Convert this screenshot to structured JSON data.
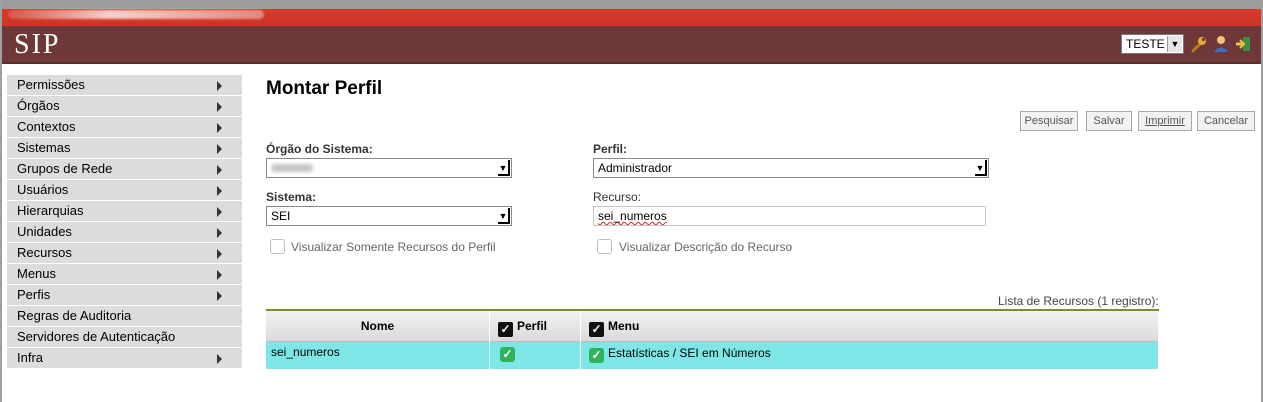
{
  "header": {
    "app_logo": "SIP",
    "org_select_value": "TESTE",
    "icons": [
      "wrench-icon",
      "user-icon",
      "exit-icon"
    ]
  },
  "sidebar": {
    "items": [
      {
        "label": "Permissões",
        "has_submenu": true
      },
      {
        "label": "Órgãos",
        "has_submenu": true
      },
      {
        "label": "Contextos",
        "has_submenu": true
      },
      {
        "label": "Sistemas",
        "has_submenu": true
      },
      {
        "label": "Grupos de Rede",
        "has_submenu": true
      },
      {
        "label": "Usuários",
        "has_submenu": true
      },
      {
        "label": "Hierarquias",
        "has_submenu": true
      },
      {
        "label": "Unidades",
        "has_submenu": true
      },
      {
        "label": "Recursos",
        "has_submenu": true
      },
      {
        "label": "Menus",
        "has_submenu": true
      },
      {
        "label": "Perfis",
        "has_submenu": true
      },
      {
        "label": "Regras de Auditoria",
        "has_submenu": false
      },
      {
        "label": "Servidores de Autenticação",
        "has_submenu": false
      },
      {
        "label": "Infra",
        "has_submenu": true
      }
    ]
  },
  "main": {
    "title": "Montar Perfil",
    "buttons": {
      "pesquisar": "Pesquisar",
      "salvar": "Salvar",
      "imprimir": "Imprimir",
      "cancelar": "Cancelar"
    },
    "form": {
      "orgao_label": "Órgão do Sistema:",
      "orgao_value": "",
      "perfil_label": "Perfil:",
      "perfil_value": "Administrador",
      "sistema_label": "Sistema:",
      "sistema_value": "SEI",
      "recurso_label": "Recurso:",
      "recurso_value": "sei_numeros",
      "chk_somente_recursos": "Visualizar Somente Recursos do Perfil",
      "chk_descricao": "Visualizar Descrição do Recurso"
    },
    "list_caption": "Lista de Recursos (1 registro):",
    "table": {
      "headers": {
        "nome": "Nome",
        "perfil": "Perfil",
        "menu": "Menu"
      },
      "rows": [
        {
          "nome": "sei_numeros",
          "perfil_checked": true,
          "menu_checked": true,
          "menu": "Estatísticas / SEI em Números"
        }
      ]
    }
  },
  "colors": {
    "topbar_red": "#cf3324",
    "header_brown": "#6e3838",
    "row_highlight": "#7ee6e6",
    "check_green": "#2fb35b"
  }
}
